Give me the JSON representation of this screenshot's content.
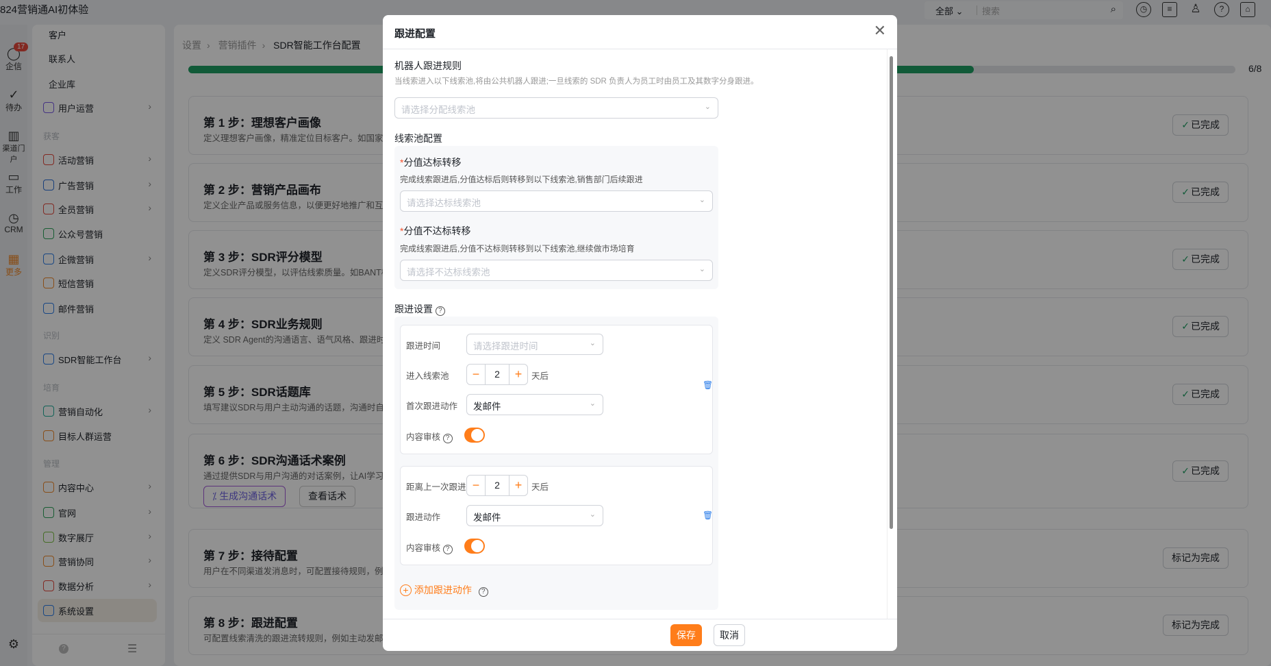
{
  "app": {
    "title": "824营销通AI初体验"
  },
  "topbar": {
    "scope": "全部",
    "search_placeholder": "搜索",
    "icons": [
      "clock-icon",
      "document-icon",
      "contacts-icon",
      "help-icon",
      "store-icon"
    ]
  },
  "rail": {
    "items": [
      {
        "label": "企信",
        "badge": "17"
      },
      {
        "label": "待办"
      },
      {
        "label": "渠道门户"
      },
      {
        "label": "工作"
      },
      {
        "label": "CRM"
      },
      {
        "label": "更多"
      }
    ]
  },
  "sidebar": {
    "items": [
      {
        "type": "item",
        "label": "客户",
        "icon": false
      },
      {
        "type": "item",
        "label": "联系人",
        "icon": false
      },
      {
        "type": "item",
        "label": "企业库",
        "icon": false
      },
      {
        "type": "item",
        "label": "用户运营",
        "color": "#7a5be6",
        "chev": true
      },
      {
        "type": "group",
        "label": "获客"
      },
      {
        "type": "item",
        "label": "活动营销",
        "color": "#e5483d",
        "chev": true
      },
      {
        "type": "item",
        "label": "广告营销",
        "color": "#2b6fd8",
        "chev": true
      },
      {
        "type": "item",
        "label": "全员营销",
        "color": "#e5483d",
        "chev": true
      },
      {
        "type": "item",
        "label": "公众号营销",
        "color": "#2ba45a"
      },
      {
        "type": "item",
        "label": "企微营销",
        "color": "#2b7de9",
        "chev": true
      },
      {
        "type": "item",
        "label": "短信营销",
        "color": "#f08a2b"
      },
      {
        "type": "item",
        "label": "邮件营销",
        "color": "#2b7de9"
      },
      {
        "type": "group",
        "label": "识别"
      },
      {
        "type": "item",
        "label": "SDR智能工作台",
        "color": "#2b7de9",
        "chev": true
      },
      {
        "type": "group",
        "label": "培育"
      },
      {
        "type": "item",
        "label": "营销自动化",
        "color": "#1fae9a",
        "chev": true
      },
      {
        "type": "item",
        "label": "目标人群运营",
        "color": "#f08a2b"
      },
      {
        "type": "group",
        "label": "管理"
      },
      {
        "type": "item",
        "label": "内容中心",
        "color": "#f08a2b",
        "chev": true
      },
      {
        "type": "item",
        "label": "官网",
        "color": "#2ba45a",
        "chev": true
      },
      {
        "type": "item",
        "label": "数字展厅",
        "color": "#7bc043",
        "chev": true
      },
      {
        "type": "item",
        "label": "营销协同",
        "color": "#f08a2b",
        "chev": true
      },
      {
        "type": "item",
        "label": "数据分析",
        "color": "#e5483d",
        "chev": true
      },
      {
        "type": "item",
        "label": "系统设置",
        "color": "#2b7de9",
        "active": true
      }
    ]
  },
  "breadcrumb": [
    "设置",
    "营销插件",
    "SDR智能工作台配置"
  ],
  "progress": {
    "done": 6,
    "total": 8,
    "label": "6/8",
    "fraction": 0.75,
    "color": "#1e9e63"
  },
  "steps": [
    {
      "title": "第 1 步：理想客户画像",
      "desc": "定义理想客户画像，精准定位目标客户。如国家、",
      "status": "已完成"
    },
    {
      "title": "第 2 步：营销产品画布",
      "desc": "定义企业产品或服务信息，以便更好地推广和互动",
      "status": "已完成"
    },
    {
      "title": "第 3 步：SDR评分模型",
      "desc": "定义SDR评分模型，以评估线索质量。如BANT模",
      "status": "已完成"
    },
    {
      "title": "第 4 步：SDR业务规则",
      "desc": "定义 SDR Agent的沟通语言、语气风格、跟进时段",
      "status": "已完成"
    },
    {
      "title": "第 5 步：SDR话题库",
      "desc": "填写建议SDR与用户主动沟通的话题，沟通时自动",
      "status": "已完成"
    },
    {
      "title": "第 6 步：SDR沟通话术案例",
      "desc": "通过提供SDR与用户沟通的对话案例，让AI学习以",
      "status": "已完成",
      "buttons": [
        "生成沟通话术",
        "查看话术"
      ]
    },
    {
      "title": "第 7 步：接待配置",
      "desc": "用户在不同渠道发消息时，可配置接待规则，例如",
      "status": "标记为完成"
    },
    {
      "title": "第 8 步：跟进配置",
      "desc": "可配置线索清洗的跟进流转规则，例如主动发邮件",
      "status": "标记为完成"
    }
  ],
  "modal": {
    "title": "跟进配置",
    "robot": {
      "title": "机器人跟进规则",
      "desc": "当线索进入以下线索池,将由公共机器人跟进;一旦线索的 SDR 负责人为员工时由员工及其数字分身跟进。",
      "placeholder": "请选择分配线索池"
    },
    "pool": {
      "title": "线索池配置",
      "pass": {
        "label": "分值达标转移",
        "desc": "完成线索跟进后,分值达标后则转移到以下线索池,销售部门后续跟进",
        "placeholder": "请选择达标线索池"
      },
      "fail": {
        "label": "分值不达标转移",
        "desc": "完成线索跟进后,分值不达标则转移到以下线索池,继续做市场培育",
        "placeholder": "请选择不达标线索池"
      }
    },
    "follow": {
      "title": "跟进设置",
      "card1": {
        "time_label": "跟进时间",
        "time_placeholder": "请选择跟进时间",
        "enter_label": "进入线索池",
        "enter_value": "2",
        "unit": "天后",
        "action_label": "首次跟进动作",
        "action_value": "发邮件",
        "review_label": "内容审核",
        "review_on": true
      },
      "card2": {
        "gap_label": "距离上一次跟进",
        "gap_value": "2",
        "unit": "天后",
        "action_label": "跟进动作",
        "action_value": "发邮件",
        "review_label": "内容审核",
        "review_on": true
      },
      "add_label": "添加跟进动作"
    },
    "save": "保存",
    "cancel": "取消",
    "accent": "#ff7d1a"
  }
}
